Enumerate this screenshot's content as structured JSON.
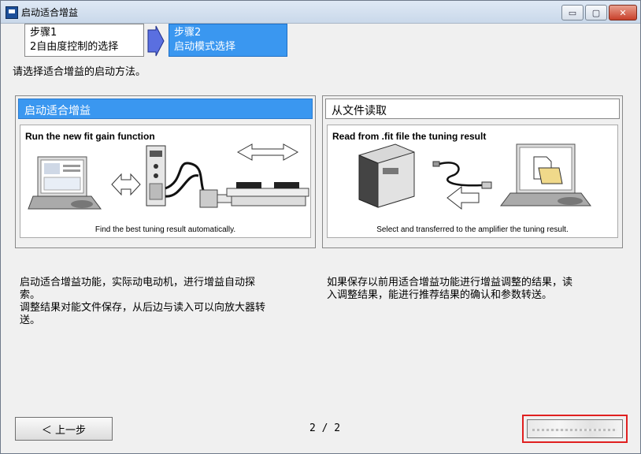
{
  "window": {
    "title": "启动适合增益",
    "min_glyph": "▭",
    "max_glyph": "▢",
    "close_glyph": "✕"
  },
  "steps": [
    {
      "line1": "步骤1",
      "line2": "2自由度控制的选择"
    },
    {
      "line1": "步骤2",
      "line2": "启动模式选择"
    }
  ],
  "instruction": "请选择适合增益的启动方法。",
  "options": [
    {
      "header": "启动适合增益",
      "image_title": "Run the new fit gain function",
      "image_caption": "Find the best tuning result automatically.",
      "description": "启动适合增益功能，实际动电动机，进行增益自动探\n索。\n调整结果对能文件保存，从后边与读入可以向放大器转\n送。"
    },
    {
      "header": "从文件读取",
      "image_title": "Read from .fit file the tuning result",
      "image_caption": "Select and transferred to the amplifier the tuning result.",
      "description": "如果保存以前用适合增益功能进行增益调整的结果，读\n入调整结果，能进行推荐结果的确认和参数转送。"
    }
  ],
  "footer": {
    "back_label": "＜ 上一步",
    "page_indicator": "2 / 2"
  },
  "colors": {
    "accent": "#3a97f0",
    "highlight_border": "#e02020"
  }
}
